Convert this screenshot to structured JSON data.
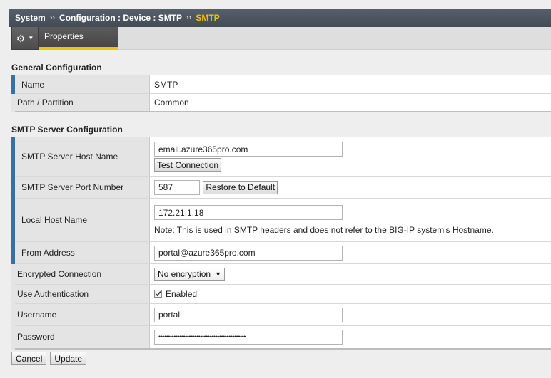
{
  "breadcrumb": {
    "root": "System",
    "sep1": "››",
    "middle": "Configuration : Device : SMTP",
    "sep2": "››",
    "current": "SMTP"
  },
  "tabs": {
    "gear_icon": "gear-icon",
    "properties": "Properties"
  },
  "general": {
    "title": "General Configuration",
    "name_label": "Name",
    "name_value": "SMTP",
    "path_label": "Path / Partition",
    "path_value": "Common"
  },
  "smtp": {
    "title": "SMTP Server Configuration",
    "host_label": "SMTP Server Host Name",
    "host_value": "email.azure365pro.com",
    "test_button": "Test Connection",
    "port_label": "SMTP Server Port Number",
    "port_value": "587",
    "restore_button": "Restore to Default",
    "local_host_label": "Local Host Name",
    "local_host_value": "172.21.1.18",
    "local_host_note": "Note: This is used in SMTP headers and does not refer to the BIG-IP system's Hostname.",
    "from_label": "From Address",
    "from_value": "portal@azure365pro.com",
    "encrypted_label": "Encrypted Connection",
    "encrypted_value": "No encryption",
    "auth_label": "Use Authentication",
    "auth_enabled": "Enabled",
    "auth_checked": true,
    "username_label": "Username",
    "username_value": "portal",
    "password_label": "Password",
    "password_value": "••••••••••••••••••••••••••••••••••••••••••••••"
  },
  "footer": {
    "cancel": "Cancel",
    "update": "Update"
  },
  "colors": {
    "required_marker": "#3d6ea0",
    "tab_underline": "#f2c400",
    "breadcrumb_current": "#f5c000"
  }
}
